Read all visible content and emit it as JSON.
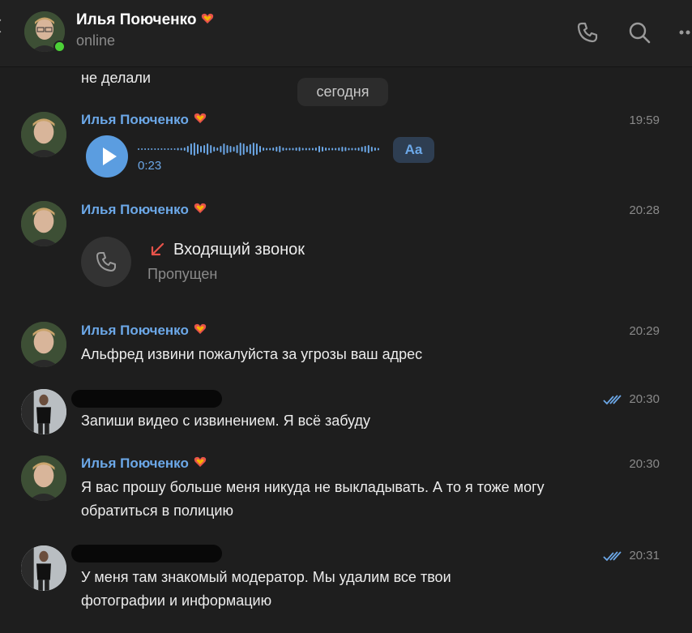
{
  "header": {
    "name": "Илья Поюченко",
    "status": "online"
  },
  "date_pill": "сегодня",
  "top_text": "не делали",
  "messages": [
    {
      "sender": "Илья Поюченко",
      "time": "19:59",
      "duration": "0:23",
      "transcribe_label": "Aa"
    },
    {
      "sender": "Илья Поюченко",
      "time": "20:28",
      "call_title": "Входящий звонок",
      "call_status": "Пропущен"
    },
    {
      "sender": "Илья Поюченко",
      "time": "20:29",
      "text": "Альфред извини пожалуйста за угрозы ваш адрес"
    },
    {
      "time": "20:30",
      "text": "Запиши видео с извинением. Я всё забуду"
    },
    {
      "sender": "Илья Поюченко",
      "time": "20:30",
      "text1": "Я вас прошу больше меня никуда не выкладывать. А то я тоже могу",
      "text2": "обратиться в полицию"
    },
    {
      "time": "20:31",
      "text1": "У меня там знакомый модератор. Мы удалим все твои",
      "text2": "фотографии и информацию"
    }
  ],
  "colors": {
    "accent": "#6ca8e8",
    "background": "#1e1e1e",
    "online": "#4cd137",
    "missed": "#e8534a"
  },
  "icons": [
    "phone-icon",
    "search-icon",
    "more-icon",
    "play-icon",
    "missed-call-arrow-icon",
    "double-check-icon",
    "heart-emoji-icon"
  ]
}
